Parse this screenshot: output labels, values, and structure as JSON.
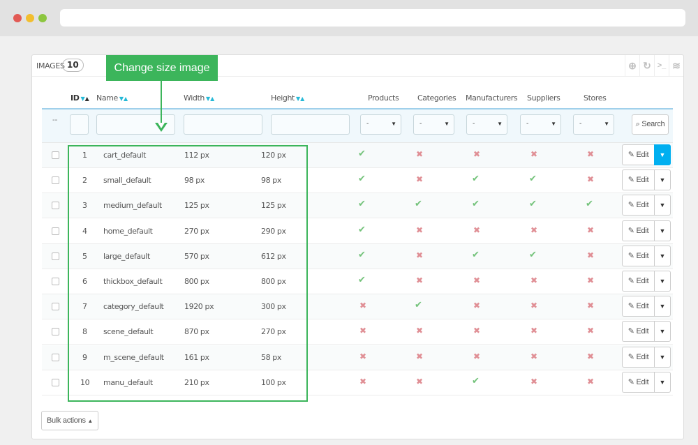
{
  "panel": {
    "title": "IMAGES",
    "count": "10"
  },
  "toolbar": {
    "icons": [
      "add-icon",
      "refresh-icon",
      "terminal-icon",
      "database-icon"
    ]
  },
  "callout": {
    "text": "Change size image",
    "color": "#3cb55b"
  },
  "columns": {
    "id": "ID",
    "name": "Name",
    "width": "Width",
    "height": "Height",
    "products": "Products",
    "categories": "Categories",
    "manufacturers": "Manufacturers",
    "suppliers": "Suppliers",
    "stores": "Stores"
  },
  "filters": {
    "dash": "--",
    "select_value": "-",
    "search_label": "Search"
  },
  "rows": [
    {
      "id": "1",
      "name": "cart_default",
      "width": "112 px",
      "height": "120 px",
      "products": true,
      "categories": false,
      "manufacturers": false,
      "suppliers": false,
      "stores": false
    },
    {
      "id": "2",
      "name": "small_default",
      "width": "98 px",
      "height": "98 px",
      "products": true,
      "categories": false,
      "manufacturers": true,
      "suppliers": true,
      "stores": false
    },
    {
      "id": "3",
      "name": "medium_default",
      "width": "125 px",
      "height": "125 px",
      "products": true,
      "categories": true,
      "manufacturers": true,
      "suppliers": true,
      "stores": true
    },
    {
      "id": "4",
      "name": "home_default",
      "width": "270 px",
      "height": "290 px",
      "products": true,
      "categories": false,
      "manufacturers": false,
      "suppliers": false,
      "stores": false
    },
    {
      "id": "5",
      "name": "large_default",
      "width": "570 px",
      "height": "612 px",
      "products": true,
      "categories": false,
      "manufacturers": true,
      "suppliers": true,
      "stores": false
    },
    {
      "id": "6",
      "name": "thickbox_default",
      "width": "800 px",
      "height": "800 px",
      "products": true,
      "categories": false,
      "manufacturers": false,
      "suppliers": false,
      "stores": false
    },
    {
      "id": "7",
      "name": "category_default",
      "width": "1920 px",
      "height": "300 px",
      "products": false,
      "categories": true,
      "manufacturers": false,
      "suppliers": false,
      "stores": false
    },
    {
      "id": "8",
      "name": "scene_default",
      "width": "870 px",
      "height": "270 px",
      "products": false,
      "categories": false,
      "manufacturers": false,
      "suppliers": false,
      "stores": false
    },
    {
      "id": "9",
      "name": "m_scene_default",
      "width": "161 px",
      "height": "58 px",
      "products": false,
      "categories": false,
      "manufacturers": false,
      "suppliers": false,
      "stores": false
    },
    {
      "id": "10",
      "name": "manu_default",
      "width": "210 px",
      "height": "100 px",
      "products": false,
      "categories": false,
      "manufacturers": true,
      "suppliers": false,
      "stores": false
    }
  ],
  "row_actions": {
    "edit_label": "Edit"
  },
  "footer": {
    "bulk_label": "Bulk actions"
  },
  "colors": {
    "check": "#72c279",
    "cross": "#e08f95",
    "accent": "#25b9d7",
    "active_caret": "#00aff0"
  }
}
